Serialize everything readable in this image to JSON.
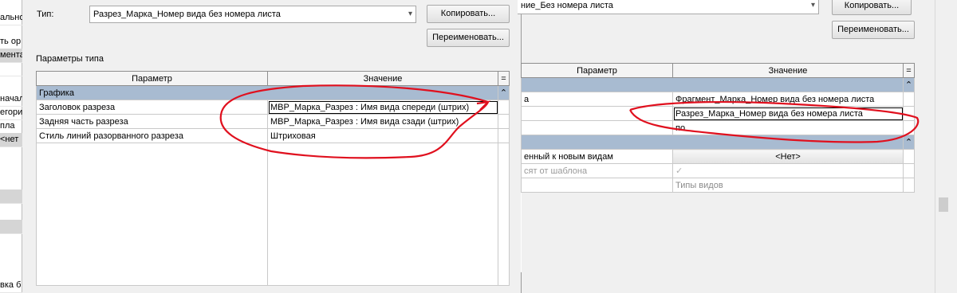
{
  "left_sliver": {
    "rows": [
      "ально",
      "",
      "ть ор",
      "мента",
      "",
      "",
      "начал",
      "егори",
      "пла",
      "<нет",
      "",
      "",
      "",
      "",
      "",
      "",
      "",
      "",
      "",
      "",
      "вка б"
    ]
  },
  "dialog": {
    "type_label": "Тип:",
    "type_value": "Разрез_Марка_Номер вида без номера листа",
    "copy_button": "Копировать...",
    "rename_button": "Переименовать...",
    "type_params_label": "Параметры типа",
    "table": {
      "col_param": "Параметр",
      "col_value": "Значение",
      "col_eq": "=",
      "group": "Графика",
      "group_toggle": "⌃",
      "rows": [
        {
          "param": "Заголовок разреза",
          "value": "МВР_Марка_Разрез : Имя вида спереди  (штрих)"
        },
        {
          "param": "Задняя часть разреза",
          "value": "МВР_Марка_Разрез : Имя вида сзади  (штрих)"
        },
        {
          "param": "Стиль линий разорванного разреза",
          "value": "Штриховая"
        }
      ]
    }
  },
  "right_window": {
    "type_value": "ние_Без номера листа",
    "copy_button": "Копировать...",
    "rename_button": "Переименовать...",
    "table": {
      "col_param": "Параметр",
      "col_value": "Значение",
      "col_eq": "=",
      "group_toggle": "⌃",
      "rows": [
        {
          "param": "а",
          "value": "Фрагмент_Марка_Номер вида без номера листа"
        },
        {
          "param": "",
          "value": "Разрез_Марка_Номер вида без номера листа"
        },
        {
          "param": "",
          "value": "по"
        }
      ],
      "rows2": [
        {
          "param": "енный к новым видам",
          "value": "<Нет>"
        },
        {
          "param": "сят от шаблона",
          "value": "✓"
        },
        {
          "param": "",
          "value": "Типы видов"
        }
      ]
    }
  },
  "annotation_color": "#e0101e"
}
